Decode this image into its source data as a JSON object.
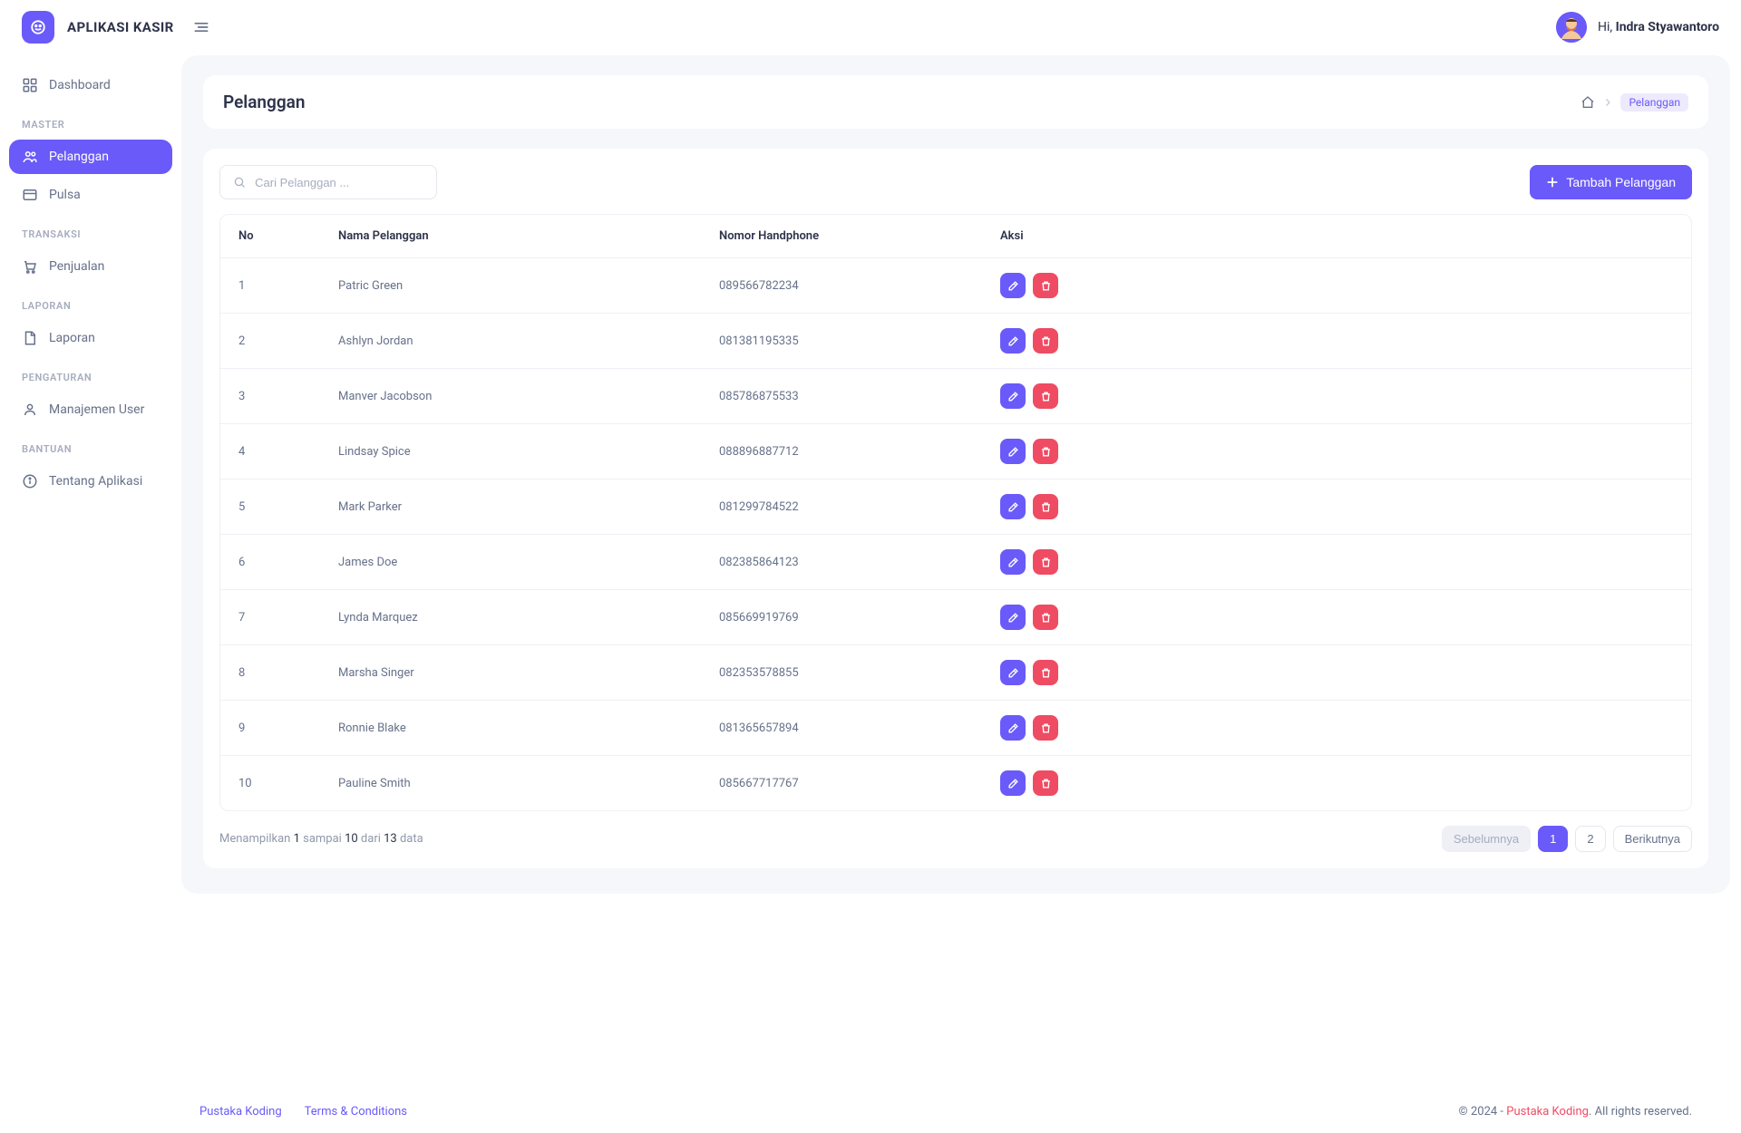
{
  "app": {
    "title": "APLIKASI KASIR"
  },
  "user": {
    "greeting": "Hi,",
    "name": "Indra Styawantoro"
  },
  "sidebar": {
    "dashboard": "Dashboard",
    "sections": {
      "master": "MASTER",
      "transaksi": "TRANSAKSI",
      "laporan": "LAPORAN",
      "pengaturan": "PENGATURAN",
      "bantuan": "BANTUAN"
    },
    "items": {
      "pelanggan": "Pelanggan",
      "pulsa": "Pulsa",
      "penjualan": "Penjualan",
      "laporan": "Laporan",
      "manajemen_user": "Manajemen User",
      "tentang_aplikasi": "Tentang Aplikasi"
    }
  },
  "page": {
    "title": "Pelanggan",
    "breadcrumb_current": "Pelanggan"
  },
  "search": {
    "placeholder": "Cari Pelanggan ..."
  },
  "buttons": {
    "add": "Tambah Pelanggan"
  },
  "table": {
    "headers": {
      "no": "No",
      "nama": "Nama Pelanggan",
      "phone": "Nomor Handphone",
      "aksi": "Aksi"
    },
    "rows": [
      {
        "no": "1",
        "nama": "Patric Green",
        "phone": "089566782234"
      },
      {
        "no": "2",
        "nama": "Ashlyn Jordan",
        "phone": "081381195335"
      },
      {
        "no": "3",
        "nama": "Manver Jacobson",
        "phone": "085786875533"
      },
      {
        "no": "4",
        "nama": "Lindsay Spice",
        "phone": "088896887712"
      },
      {
        "no": "5",
        "nama": "Mark Parker",
        "phone": "081299784522"
      },
      {
        "no": "6",
        "nama": "James Doe",
        "phone": "082385864123"
      },
      {
        "no": "7",
        "nama": "Lynda Marquez",
        "phone": "085669919769"
      },
      {
        "no": "8",
        "nama": "Marsha Singer",
        "phone": "082353578855"
      },
      {
        "no": "9",
        "nama": "Ronnie Blake",
        "phone": "081365657894"
      },
      {
        "no": "10",
        "nama": "Pauline Smith",
        "phone": "085667717767"
      }
    ]
  },
  "pagination": {
    "info_pre": "Menampilkan ",
    "from": "1",
    "mid1": " sampai ",
    "to": "10",
    "mid2": " dari ",
    "total": "13",
    "suffix": " data",
    "prev": "Sebelumnya",
    "next": "Berikutnya",
    "pages": [
      "1",
      "2"
    ]
  },
  "footer": {
    "link1": "Pustaka Koding",
    "link2": "Terms & Conditions",
    "copyright_pre": "© 2024 - ",
    "brand": "Pustaka Koding",
    "copyright_post": ". All rights reserved."
  }
}
